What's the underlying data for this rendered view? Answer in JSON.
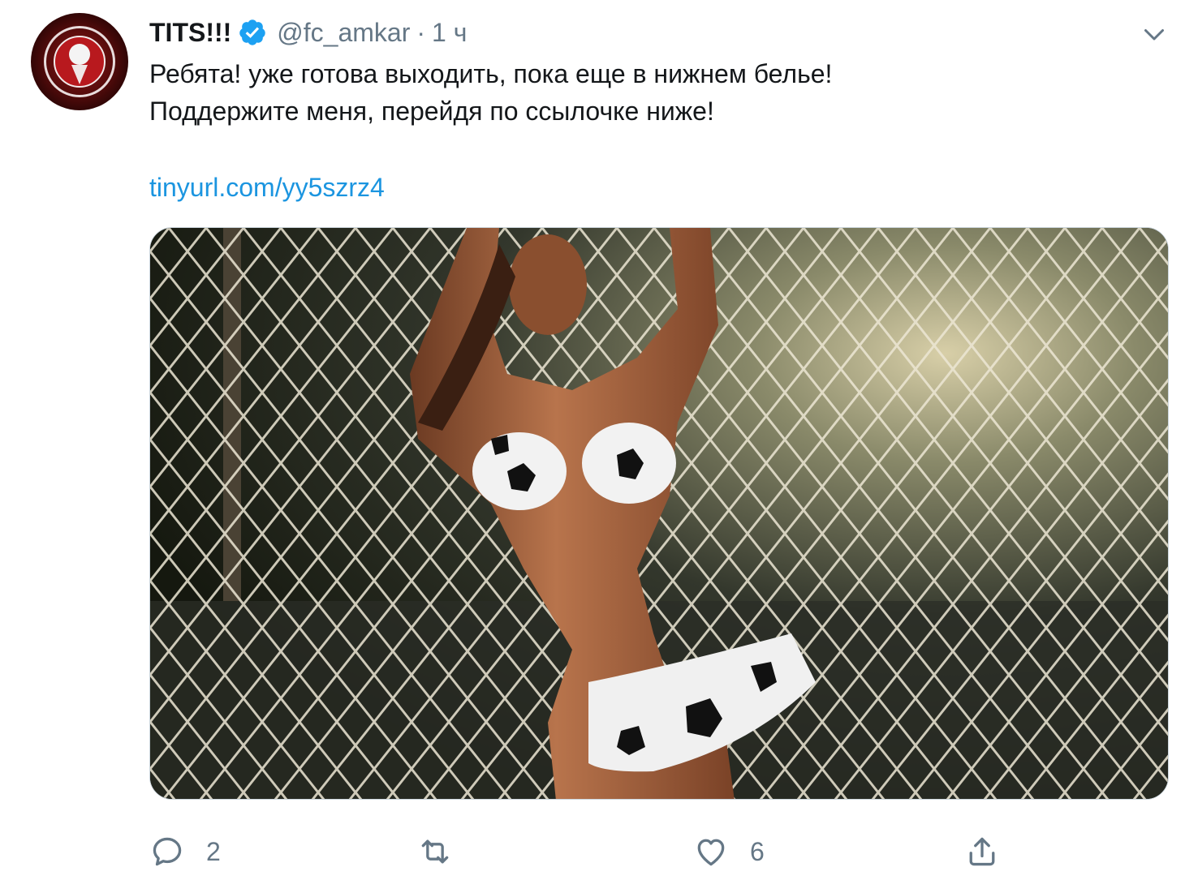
{
  "tweet": {
    "author": {
      "display_name": "TITS!!!",
      "handle": "@fc_amkar",
      "verified": true,
      "avatar_icon": "club-crest-avatar"
    },
    "separator": "·",
    "time": "1 ч",
    "text_lines": [
      "Ребята! уже готова выходить, пока еще в нижнем белье!",
      "Поддержите меня, перейдя по ссылочке ниже!"
    ],
    "link": "tinyurl.com/yy5szrz4",
    "media": {
      "type": "photo",
      "icon": "photo"
    },
    "actions": {
      "reply": {
        "icon": "reply-icon",
        "count": "2"
      },
      "retweet": {
        "icon": "retweet-icon",
        "count": ""
      },
      "like": {
        "icon": "heart-icon",
        "count": "6"
      },
      "share": {
        "icon": "share-icon"
      }
    }
  },
  "colors": {
    "text_primary": "#14171a",
    "text_secondary": "#657786",
    "link": "#1b95e0",
    "verified": "#1da1f2"
  }
}
